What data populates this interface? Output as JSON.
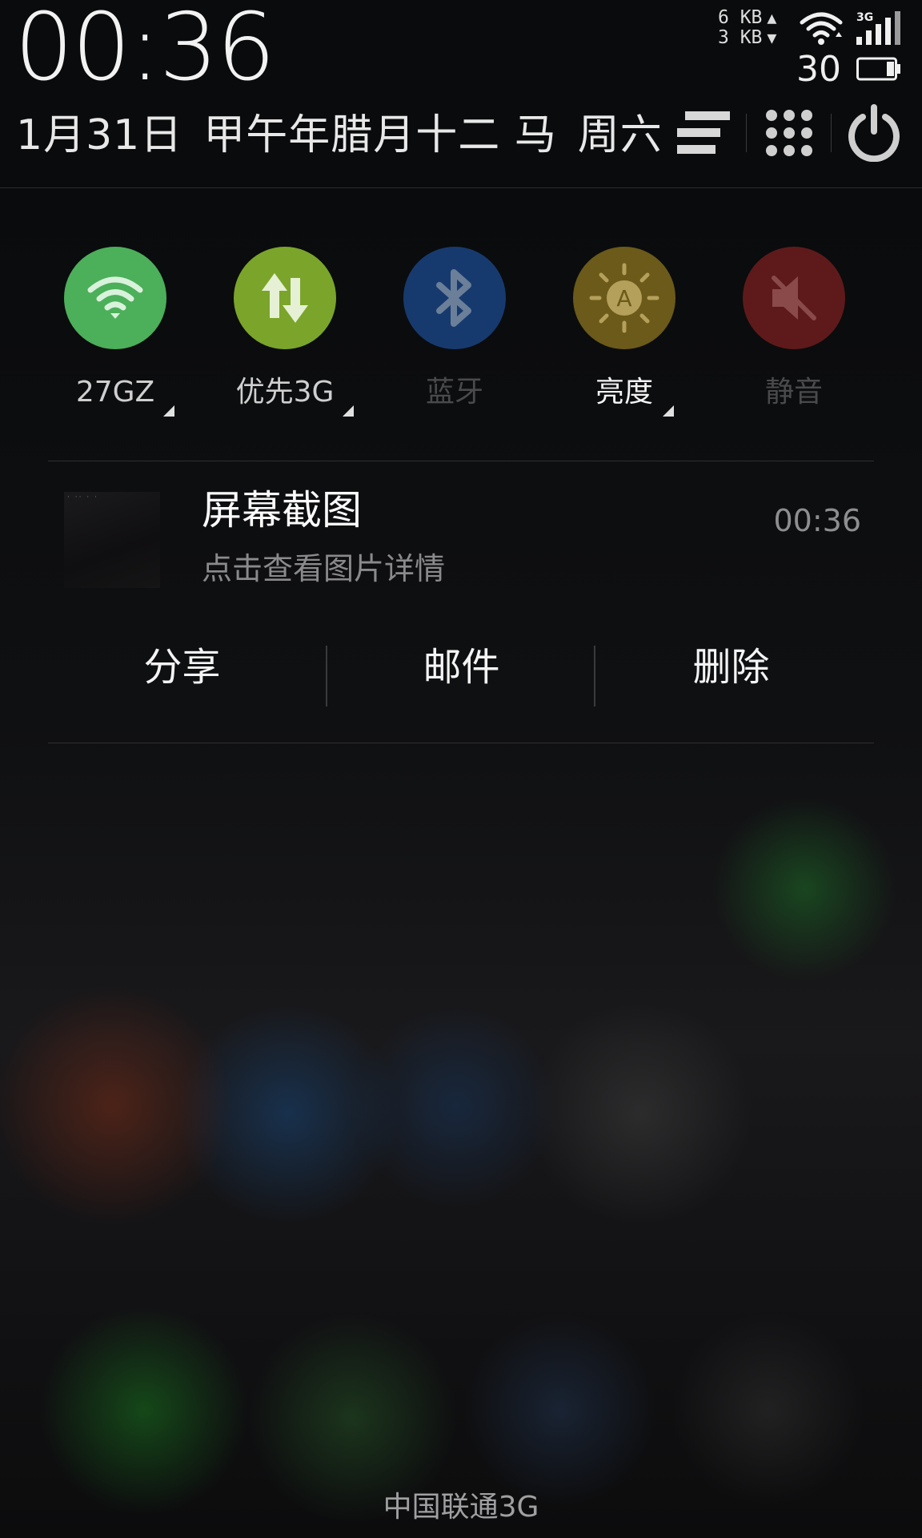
{
  "status": {
    "clock": "00:36",
    "net_up": "6 KB",
    "net_down": "3 KB",
    "network_type": "3G",
    "battery": "30",
    "icons": [
      "wifi-icon",
      "signal-3g-icon",
      "battery-icon"
    ]
  },
  "header": {
    "date": "1月31日",
    "lunar": "甲午年腊月十二 马",
    "weekday": "周六",
    "buttons": [
      "list-menu-icon",
      "app-grid-icon",
      "power-icon"
    ]
  },
  "toggles": [
    {
      "label": "27GZ",
      "color": "#4caf5a",
      "icon": "wifi-icon",
      "active": true
    },
    {
      "label": "优先3G",
      "color": "#7aa52a",
      "icon": "data-transfer-icon",
      "active": true
    },
    {
      "label": "蓝牙",
      "color": "#173a6e",
      "icon": "bluetooth-icon",
      "active": false
    },
    {
      "label": "亮度",
      "color": "#6b5a19",
      "icon": "brightness-auto-icon",
      "active": true
    },
    {
      "label": "静音",
      "color": "#5e1a1a",
      "icon": "mute-icon",
      "active": false
    }
  ],
  "notification": {
    "title": "屏幕截图",
    "subtitle": "点击查看图片详情",
    "time": "00:36",
    "actions": {
      "share": "分享",
      "mail": "邮件",
      "delete": "删除"
    }
  },
  "carrier": "中国联通3G"
}
